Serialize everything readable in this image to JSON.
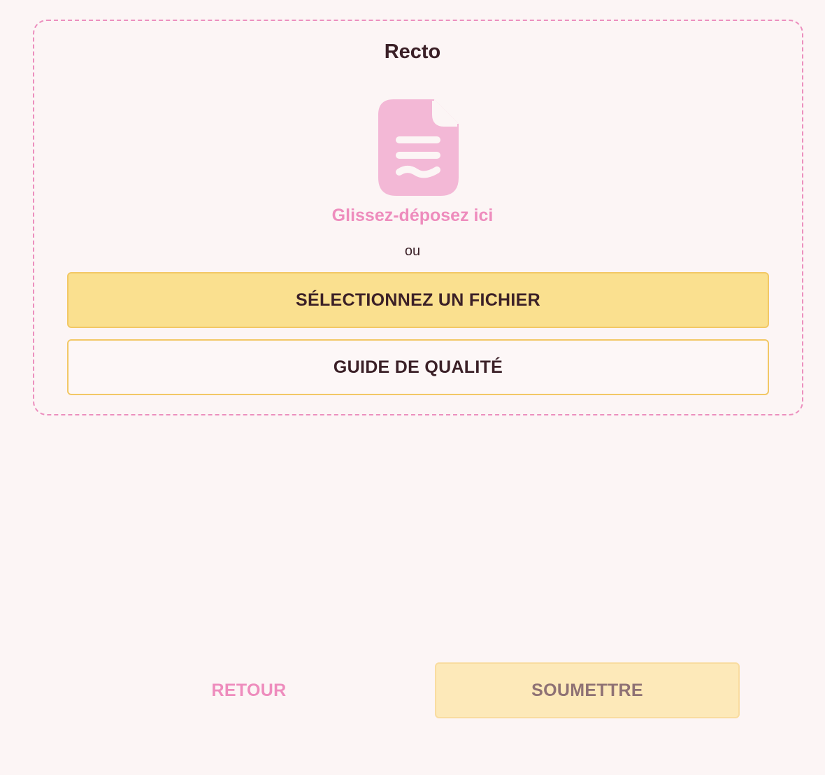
{
  "upload": {
    "title": "Recto",
    "icon": "document-icon",
    "drop_hint": "Glissez-déposez ici",
    "or": "ou",
    "select_button": "SÉLECTIONNEZ UN FICHIER",
    "guide_button": "GUIDE DE QUALITÉ"
  },
  "footer": {
    "back_label": "RETOUR",
    "submit_label": "SOUMETTRE",
    "submit_state": "disabled"
  },
  "colors": {
    "accent_pink": "#ee8cbd",
    "primary_yellow": "#fae08f",
    "text_dark": "#3b2027",
    "background": "#fcf5f5"
  }
}
